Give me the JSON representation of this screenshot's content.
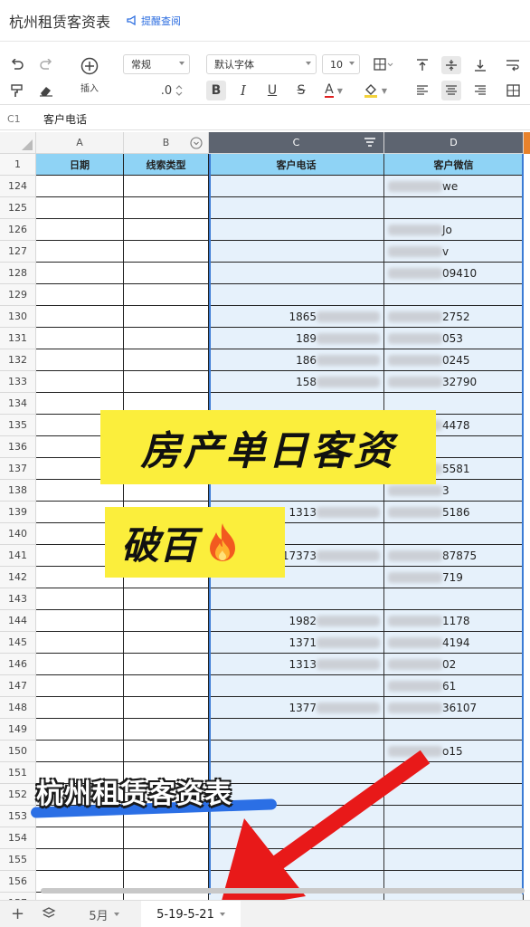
{
  "app": {
    "title": "杭州租赁客资表",
    "remind_label": "提醒查阅"
  },
  "toolbar": {
    "insert_label": "插入",
    "format_value": "常规",
    "font_value": "默认字体",
    "size_value": "10",
    "decimal_value": ".0"
  },
  "formula": {
    "cell_ref": "C1",
    "content": "客户电话"
  },
  "columns": [
    "A",
    "B",
    "C",
    "D"
  ],
  "header_row": {
    "num": "1",
    "a": "日期",
    "b": "线索类型",
    "c": "客户电话",
    "d": "客户微信"
  },
  "rows": [
    {
      "num": "124",
      "c": "",
      "d": "we"
    },
    {
      "num": "125",
      "c": "",
      "d": ""
    },
    {
      "num": "126",
      "c": "",
      "d": "Jo"
    },
    {
      "num": "127",
      "c": "",
      "d": "v"
    },
    {
      "num": "128",
      "c": "",
      "d": "09410"
    },
    {
      "num": "129",
      "c": "",
      "d": ""
    },
    {
      "num": "130",
      "c": "1865",
      "d": "2752"
    },
    {
      "num": "131",
      "c": "189",
      "d": "053"
    },
    {
      "num": "132",
      "c": "186",
      "d": "0245"
    },
    {
      "num": "133",
      "c": "158",
      "d": "32790"
    },
    {
      "num": "134",
      "c": "",
      "d": ""
    },
    {
      "num": "135",
      "c": "",
      "d": "4478"
    },
    {
      "num": "136",
      "c": "",
      "d": ""
    },
    {
      "num": "137",
      "c": "",
      "d": "5581"
    },
    {
      "num": "138",
      "c": "",
      "d": "3"
    },
    {
      "num": "139",
      "c": "1313",
      "d": "5186"
    },
    {
      "num": "140",
      "c": "",
      "d": ""
    },
    {
      "num": "141",
      "c": "17373",
      "d": "87875"
    },
    {
      "num": "142",
      "c": "",
      "d": "719"
    },
    {
      "num": "143",
      "c": "",
      "d": ""
    },
    {
      "num": "144",
      "c": "1982",
      "d": "1178"
    },
    {
      "num": "145",
      "c": "1371",
      "d": "4194"
    },
    {
      "num": "146",
      "c": "1313",
      "d": "02"
    },
    {
      "num": "147",
      "c": "",
      "d": "61"
    },
    {
      "num": "148",
      "c": "1377",
      "d": "36107"
    },
    {
      "num": "149",
      "c": "",
      "d": ""
    },
    {
      "num": "150",
      "c": "",
      "d": "o15"
    },
    {
      "num": "151",
      "c": "",
      "d": ""
    },
    {
      "num": "152",
      "c": "",
      "d": ""
    },
    {
      "num": "153",
      "c": "",
      "d": ""
    },
    {
      "num": "154",
      "c": "",
      "d": ""
    },
    {
      "num": "155",
      "c": "",
      "d": ""
    },
    {
      "num": "156",
      "c": "",
      "d": ""
    },
    {
      "num": "157",
      "c": "",
      "d": ""
    }
  ],
  "overlays": {
    "headline": "房产单日客资",
    "sub": "破百",
    "caption": "杭州租赁客资表"
  },
  "sheets": [
    {
      "label": "5月"
    },
    {
      "label": "5-19-5-21"
    }
  ],
  "colors": {
    "header_fill": "#8fd3f5",
    "selection_fill": "#e6f1fb",
    "overlay_yellow": "#fbee3c",
    "arrow_red": "#e81919"
  }
}
